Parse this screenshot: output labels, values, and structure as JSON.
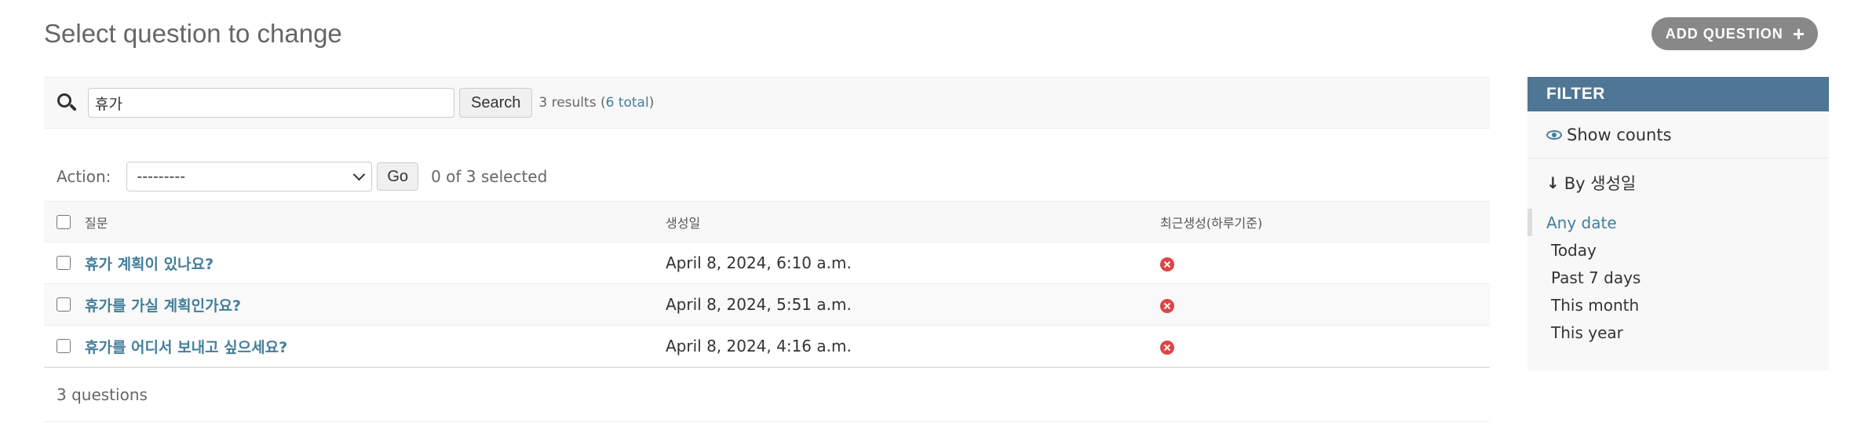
{
  "header": {
    "title": "Select question to change",
    "add_button_label": "ADD QUESTION"
  },
  "search": {
    "value": "휴가",
    "button_label": "Search",
    "results_text": "3 results (",
    "total_text": "6 total",
    "results_close": ")"
  },
  "actions": {
    "label": "Action:",
    "selected_option": "---------",
    "go_label": "Go",
    "selected_count": "0 of 3 selected"
  },
  "table": {
    "columns": [
      "질문",
      "생성일",
      "최근생성(하루기준)"
    ],
    "rows": [
      {
        "question": "휴가 계획이 있나요?",
        "date": "April 8, 2024, 6:10 a.m."
      },
      {
        "question": "휴가를 가실 계획인가요?",
        "date": "April 8, 2024, 5:51 a.m."
      },
      {
        "question": "휴가를 어디서 보내고 싶으세요?",
        "date": "April 8, 2024, 4:16 a.m."
      }
    ]
  },
  "paginator": {
    "text": "3 questions"
  },
  "filter": {
    "header": "FILTER",
    "show_counts": "Show counts",
    "group_title": "By 생성일",
    "options": [
      "Any date",
      "Today",
      "Past 7 days",
      "This month",
      "This year"
    ]
  },
  "colors": {
    "link": "#447e9b",
    "filter_header": "#4f7694",
    "add_button": "#888888",
    "status_no": "#dd4646"
  }
}
